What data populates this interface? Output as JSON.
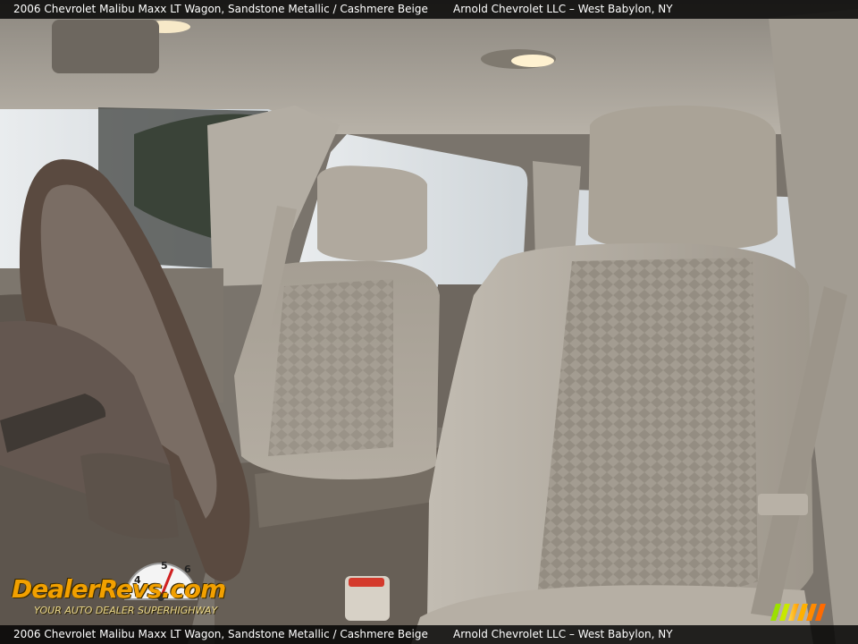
{
  "caption": {
    "vehicle": "2006 Chevrolet Malibu Maxx LT Wagon,  Sandstone Metallic / Cashmere Beige",
    "dealer": "Arnold Chevrolet LLC – West Babylon, NY"
  },
  "watermark": {
    "brand": "DealerRevs.com",
    "tagline": "YOUR AUTO DEALER SUPERHIGHWAY",
    "gauge_numbers": [
      "4",
      "5",
      "6"
    ]
  },
  "colors": {
    "headliner": "#b9b3a8",
    "upholstery": "#a79f93",
    "steering_wheel": "#5b4c43",
    "window_glass": "#dfe3e6",
    "caption_bar": "#000000",
    "watermark_orange": "#f2a000"
  }
}
